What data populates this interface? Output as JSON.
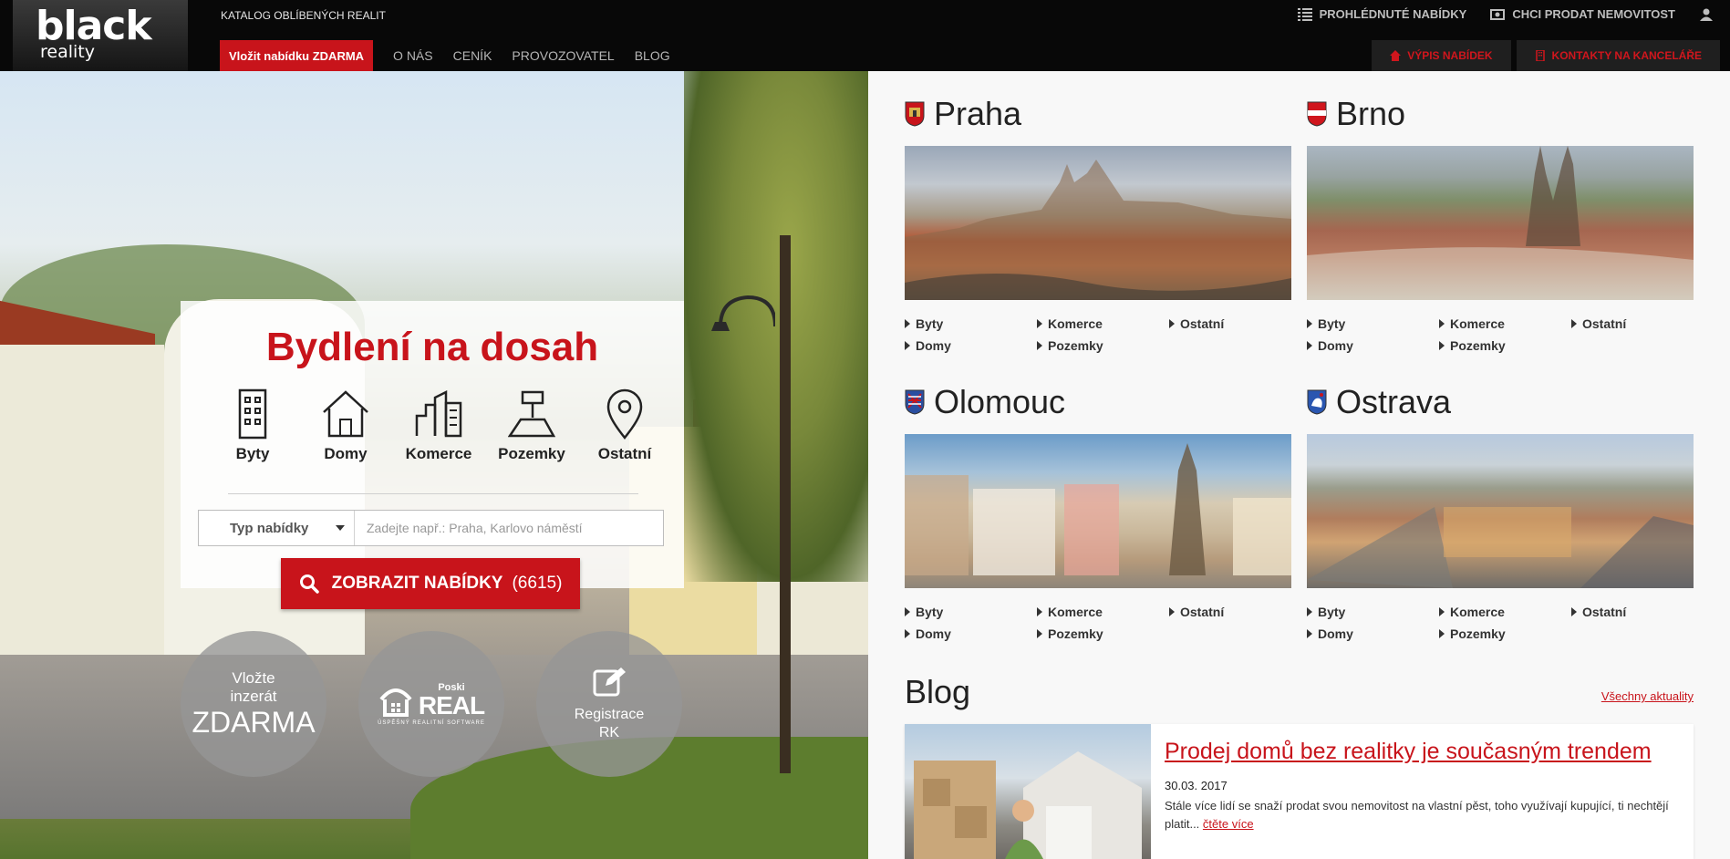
{
  "header": {
    "logo_top": "black",
    "logo_bottom": "reality",
    "catalog": "KATALOG OBLÍBENÝCH REALIT",
    "top_links": [
      {
        "icon": "list-icon",
        "label": "PROHLÉDNUTÉ NABÍDKY"
      },
      {
        "icon": "money-icon",
        "label": "CHCI PRODAT NEMOVITOST"
      },
      {
        "icon": "user-icon",
        "label": ""
      }
    ],
    "add_button": "Vložit nabídku ZDARMA",
    "nav": [
      "O NÁS",
      "CENÍK",
      "PROVOZOVATEL",
      "BLOG"
    ],
    "right_buttons": [
      {
        "icon": "home-icon",
        "label": "VÝPIS NABÍDEK"
      },
      {
        "icon": "building-icon",
        "label": "KONTAKTY NA KANCELÁŘE"
      }
    ]
  },
  "hero": {
    "title": "Bydlení na dosah",
    "categories": [
      {
        "icon": "apartment-icon",
        "label": "Byty"
      },
      {
        "icon": "house-icon",
        "label": "Domy"
      },
      {
        "icon": "commercial-icon",
        "label": "Komerce"
      },
      {
        "icon": "land-icon",
        "label": "Pozemky"
      },
      {
        "icon": "location-pin-icon",
        "label": "Ostatní"
      }
    ],
    "type_select": "Typ nabídky",
    "search_placeholder": "Zadejte např.: Praha, Karlovo náměstí",
    "show_button": "ZOBRAZIT NABÍDKY",
    "show_count": "(6615)",
    "circles": {
      "insert_l1": "Vložte",
      "insert_l2": "inzerát",
      "insert_l3": "ZDARMA",
      "poski_small": "Poski",
      "poski_big": "REAL",
      "poski_sub": "ÚSPĚŠNÝ REALITNÍ SOFTWARE",
      "register_l1": "Registrace",
      "register_l2": "RK"
    }
  },
  "cities": [
    {
      "name": "Praha",
      "links": [
        "Byty",
        "Komerce",
        "Ostatní",
        "Domy",
        "Pozemky"
      ],
      "crest_color": "#c8141b"
    },
    {
      "name": "Brno",
      "links": [
        "Byty",
        "Komerce",
        "Ostatní",
        "Domy",
        "Pozemky"
      ],
      "crest_color": "#d0161d"
    },
    {
      "name": "Olomouc",
      "links": [
        "Byty",
        "Komerce",
        "Ostatní",
        "Domy",
        "Pozemky"
      ],
      "crest_color": "#2a4ea0"
    },
    {
      "name": "Ostrava",
      "links": [
        "Byty",
        "Komerce",
        "Ostatní",
        "Domy",
        "Pozemky"
      ],
      "crest_color": "#2a56b0"
    }
  ],
  "blog": {
    "title": "Blog",
    "all_link": "Všechny aktuality",
    "post_title": "Prodej domů bez realitky je současným trendem",
    "post_date": "30.03. 2017",
    "post_text": "Stále více lidí se snaží prodat svou nemovitost na vlastní pěst, toho využívají kupující, ti nechtějí platit...",
    "read_more": "čtěte více"
  },
  "colors": {
    "accent": "#c8141b",
    "topbar": "#080808"
  }
}
